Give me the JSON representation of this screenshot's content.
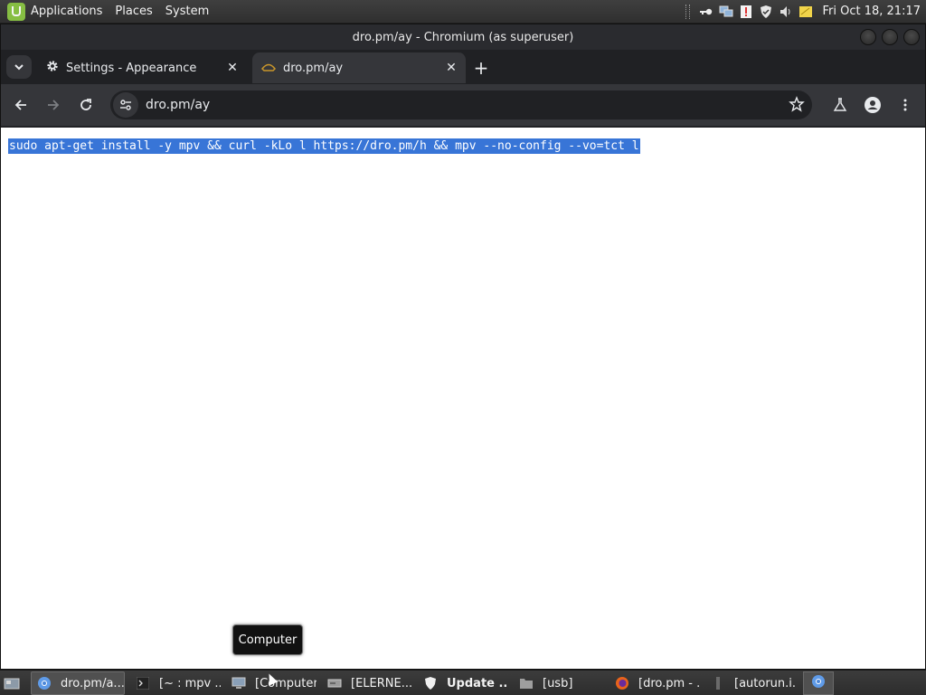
{
  "top_panel": {
    "menu": {
      "applications": "Applications",
      "places": "Places",
      "system": "System"
    },
    "tray_icons": [
      "key-icon",
      "network-icon",
      "update-icon",
      "shield-icon",
      "volume-icon",
      "notes-icon"
    ],
    "clock": "Fri Oct 18, 21:17"
  },
  "window": {
    "title": "dro.pm/ay - Chromium (as superuser)",
    "tabs": [
      {
        "label": "Settings - Appearance",
        "icon": "gear-icon",
        "active": false
      },
      {
        "label": "dro.pm/ay",
        "icon": "drop-favicon",
        "active": true
      }
    ],
    "address_bar": {
      "url": "dro.pm/ay"
    },
    "content": {
      "selected_text": "sudo apt-get install -y mpv && curl -kLo l https://dro.pm/h && mpv --no-config --vo=tct l"
    },
    "tooltip": "Computer"
  },
  "taskbar": {
    "tasks": [
      {
        "label": "dro.pm/a...",
        "icon": "chromium-icon",
        "active": true,
        "bold": false
      },
      {
        "label": "[~ : mpv ...",
        "icon": "terminal-icon",
        "active": false,
        "bold": false
      },
      {
        "label": "[Computer]",
        "icon": "computer-icon",
        "active": false,
        "bold": false
      },
      {
        "label": "[ELERNE...",
        "icon": "drive-icon",
        "active": false,
        "bold": false
      },
      {
        "label": "Update ...",
        "icon": "shield-icon",
        "active": false,
        "bold": true
      },
      {
        "label": "[usb]",
        "icon": "folder-icon",
        "active": false,
        "bold": false
      },
      {
        "label": "[dro.pm - ...",
        "icon": "firefox-icon",
        "active": false,
        "bold": false
      },
      {
        "label": "[autorun.i...",
        "icon": "text-file-icon",
        "active": false,
        "bold": false
      }
    ],
    "pinned_icon": "chromium-icon"
  },
  "colors": {
    "selection": "#3875d7",
    "browser_dark": "#202124",
    "toolbar": "#35363a",
    "mint_green": "#86be43"
  }
}
